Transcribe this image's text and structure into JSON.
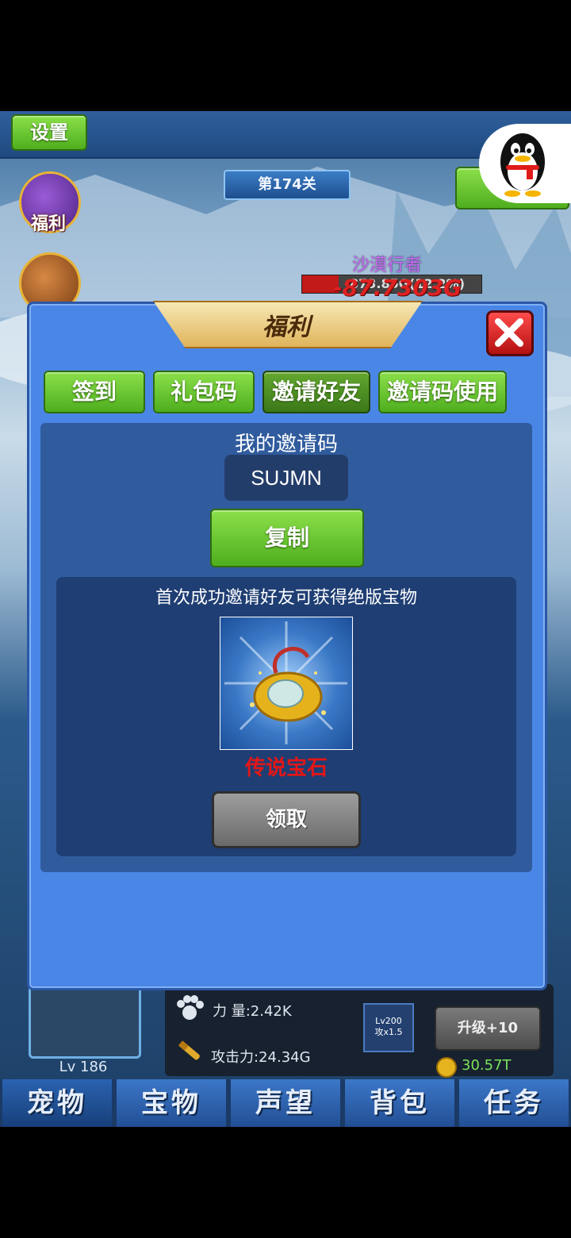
{
  "game": {
    "settings_label": "设置",
    "level_banner": "第174关",
    "welfare_icon_label": "福利",
    "enemy": {
      "name": "沙漠行者",
      "hp_text": "873.85G(12.2%)",
      "damage_text": "-87.7303G"
    },
    "stats": {
      "power_label": "力 量:2.42K",
      "attack_label": "攻击力:24.34G",
      "boost_line1": "Lv200",
      "boost_line2": "攻x1.5",
      "upgrade_label": "升级+10",
      "coin_value": "30.57T",
      "pet_level": "Lv 186"
    }
  },
  "bottom_nav": {
    "tabs": [
      {
        "label": "宠物"
      },
      {
        "label": "宝物"
      },
      {
        "label": "声望"
      },
      {
        "label": "背包"
      },
      {
        "label": "任务"
      }
    ]
  },
  "modal": {
    "title": "福利",
    "tabs": [
      {
        "label": "签到"
      },
      {
        "label": "礼包码"
      },
      {
        "label": "邀请好友"
      },
      {
        "label": "邀请码使用"
      }
    ],
    "invite": {
      "heading": "我的邀请码",
      "code": "SUJMN",
      "copy_label": "复制",
      "reward_description": "首次成功邀请好友可获得绝版宝物",
      "reward_name": "传说宝石",
      "claim_label": "领取"
    }
  },
  "colors": {
    "modal_bg": "#4a86e6",
    "button_green": "#6cc834",
    "reward_red": "#e21717"
  }
}
